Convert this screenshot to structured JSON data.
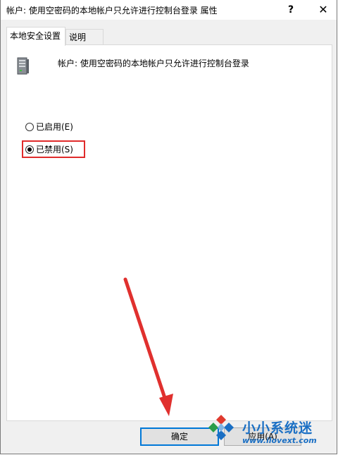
{
  "window": {
    "title": "帐户: 使用空密码的本地帐户只允许进行控制台登录 属性",
    "help_glyph": "?",
    "close_glyph": "✕"
  },
  "tabs": [
    {
      "label": "本地安全设置",
      "active": true
    },
    {
      "label": "说明",
      "active": false
    }
  ],
  "policy": {
    "icon": "server-policy-icon",
    "text": "帐户: 使用空密码的本地帐户只允许进行控制台登录"
  },
  "options": [
    {
      "label": "已启用(E)",
      "checked": false
    },
    {
      "label": "已禁用(S)",
      "checked": true
    }
  ],
  "buttons": {
    "ok": "确定",
    "cancel": "应用(A)"
  },
  "watermark": {
    "name": "小小系统迷",
    "url": "www.ilovext.com"
  },
  "colors": {
    "highlight": "#e02b2b",
    "accent": "#0078d7",
    "watermark": "#1a6fc4"
  }
}
